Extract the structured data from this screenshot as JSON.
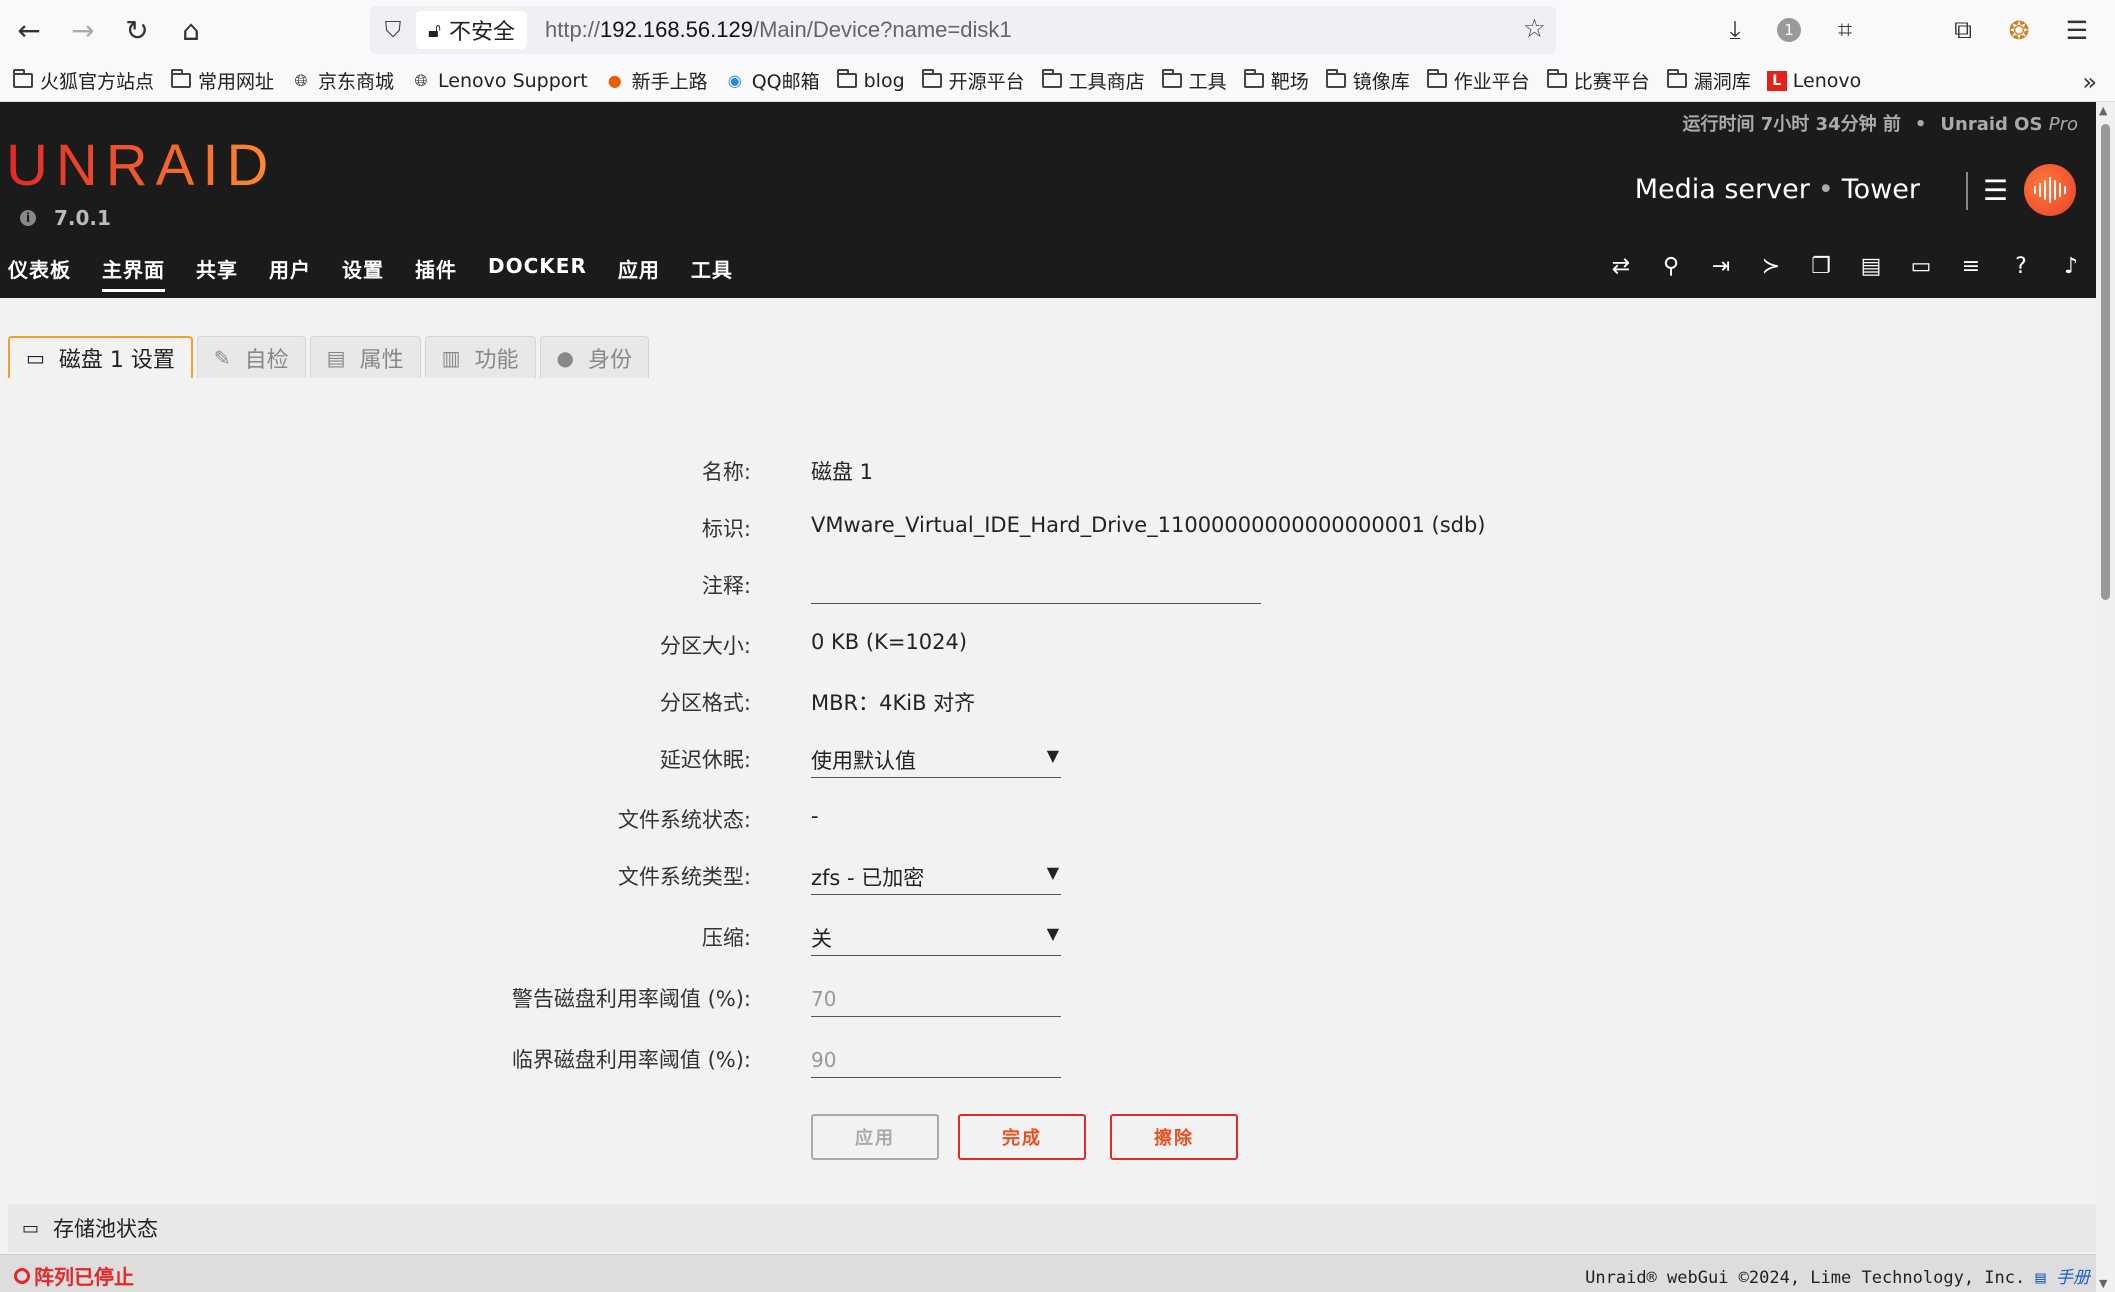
{
  "browser": {
    "url_prefix": "http://",
    "url_host": "192.168.56.129",
    "url_path": "/Main/Device?name=disk1",
    "insecure_label": "不安全",
    "notification_count": "1"
  },
  "bookmarks": [
    {
      "label": "火狐官方站点",
      "icon": "folder-icon"
    },
    {
      "label": "常用网址",
      "icon": "folder-icon"
    },
    {
      "label": "京东商城",
      "icon": "globe-icon"
    },
    {
      "label": "Lenovo Support",
      "icon": "globe-icon"
    },
    {
      "label": "新手上路",
      "icon": "firefox-icon"
    },
    {
      "label": "QQ邮箱",
      "icon": "qq-mail-icon"
    },
    {
      "label": "blog",
      "icon": "folder-icon"
    },
    {
      "label": "开源平台",
      "icon": "folder-icon"
    },
    {
      "label": "工具商店",
      "icon": "folder-icon"
    },
    {
      "label": "工具",
      "icon": "folder-icon"
    },
    {
      "label": "靶场",
      "icon": "folder-icon"
    },
    {
      "label": "镜像库",
      "icon": "folder-icon"
    },
    {
      "label": "作业平台",
      "icon": "folder-icon"
    },
    {
      "label": "比赛平台",
      "icon": "folder-icon"
    },
    {
      "label": "漏洞库",
      "icon": "folder-icon"
    },
    {
      "label": "Lenovo",
      "icon": "lenovo-icon"
    }
  ],
  "header": {
    "logo": "UNRAID",
    "version": "7.0.1",
    "uptime": "运行时间 7小时 34分钟 前",
    "os_name": "Unraid OS",
    "os_edition": "Pro",
    "server_description": "Media server",
    "server_name": "Tower",
    "brand_colors": [
      "#e22828",
      "#ff8c2f"
    ]
  },
  "nav": [
    {
      "label": "仪表板"
    },
    {
      "label": "主界面"
    },
    {
      "label": "共享"
    },
    {
      "label": "用户"
    },
    {
      "label": "设置"
    },
    {
      "label": "插件"
    },
    {
      "label": "DOCKER"
    },
    {
      "label": "应用"
    },
    {
      "label": "工具"
    }
  ],
  "nav_active": "主界面",
  "tabs": [
    {
      "label": "磁盘 1 设置",
      "icon": "hdd-icon"
    },
    {
      "label": "自检",
      "icon": "wrench-icon"
    },
    {
      "label": "属性",
      "icon": "id-card-icon"
    },
    {
      "label": "功能",
      "icon": "building-icon"
    },
    {
      "label": "身份",
      "icon": "user-icon"
    }
  ],
  "form": {
    "name_label": "名称:",
    "name_value": "磁盘 1",
    "id_label": "标识:",
    "id_value": "VMware_Virtual_IDE_Hard_Drive_11000000000000000001 (sdb)",
    "comment_label": "注释:",
    "comment_value": "",
    "partition_size_label": "分区大小:",
    "partition_size_value": "0 KB (K=1024)",
    "partition_format_label": "分区格式:",
    "partition_format_value": "MBR：4KiB 对齐",
    "spindown_label": "延迟休眠:",
    "spindown_value": "使用默认值",
    "fs_status_label": "文件系统状态:",
    "fs_status_value": "-",
    "fs_type_label": "文件系统类型:",
    "fs_type_value": "zfs - 已加密",
    "compression_label": "压缩:",
    "compression_value": "关",
    "warning_label": "警告磁盘利用率阈值 (%):",
    "warning_placeholder": "70",
    "critical_label": "临界磁盘利用率阈值 (%):",
    "critical_placeholder": "90"
  },
  "buttons": {
    "apply": "应用",
    "done": "完成",
    "clear": "擦除"
  },
  "pool": {
    "label": "存储池状态"
  },
  "footer": {
    "array_status": "阵列已停止",
    "copyright": "Unraid® webGui ©2024, Lime Technology, Inc.",
    "manual": "手册"
  }
}
